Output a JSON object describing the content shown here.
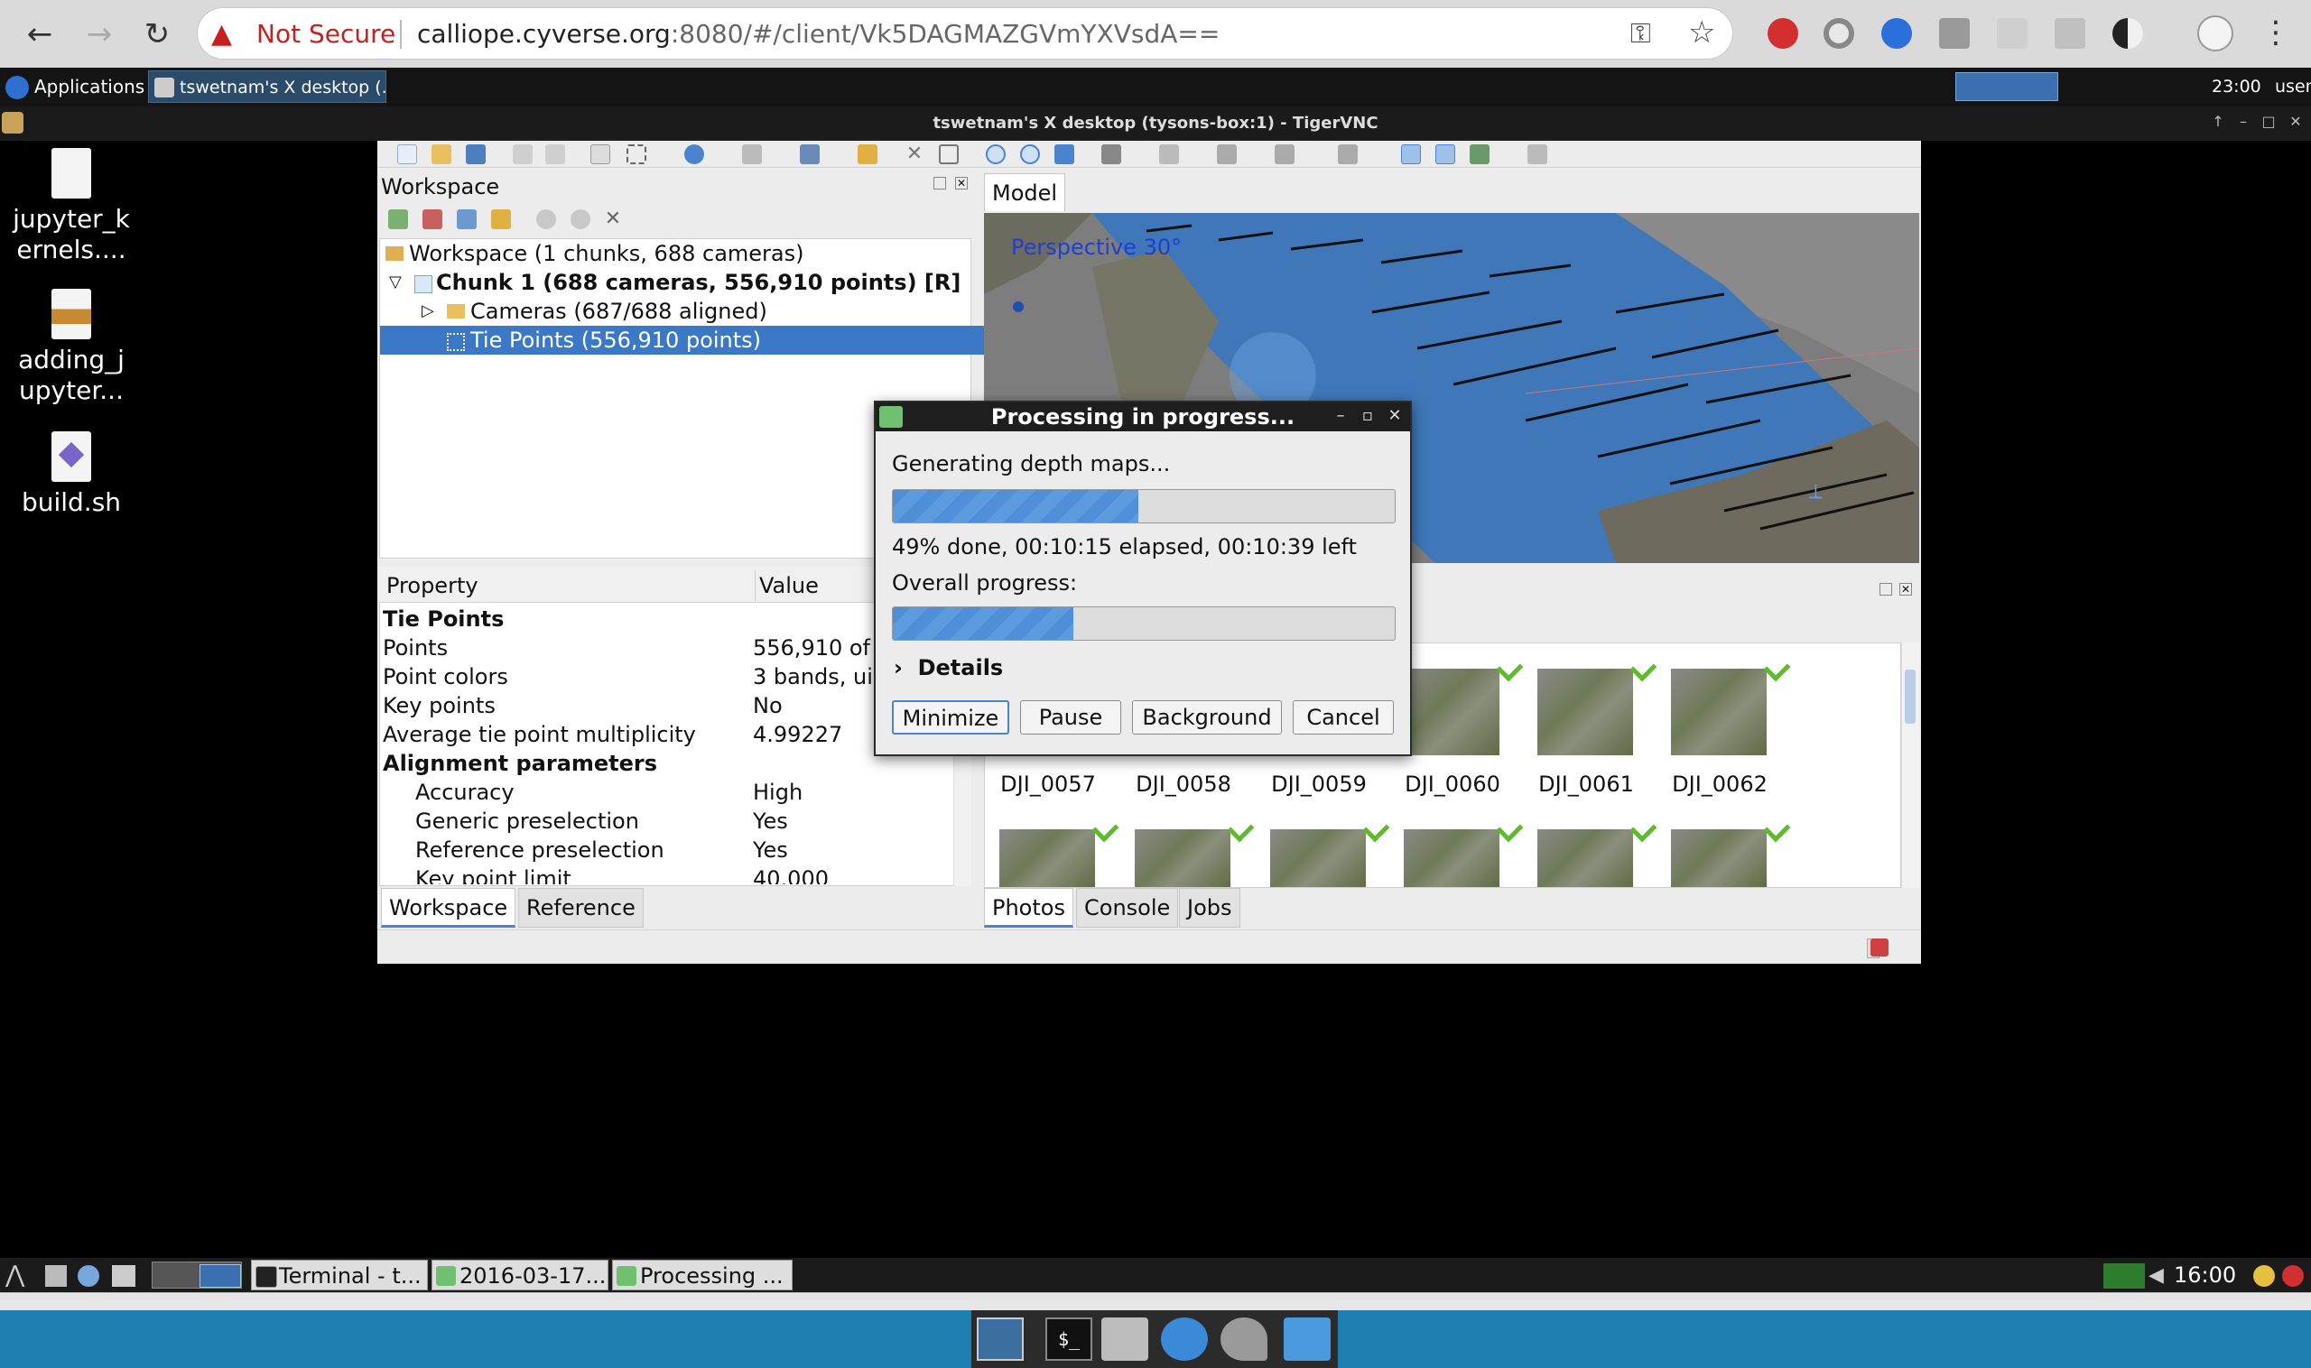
{
  "browser": {
    "security_label": "Not Secure",
    "url_host": "calliope.cyverse.org",
    "url_rest": ":8080/#/client/Vk5DAGMAZGVmYXVsdA=="
  },
  "xpanel": {
    "applications_label": "Applications",
    "task_label": "tswetnam's X desktop (...",
    "clock": "23:00",
    "user": "user"
  },
  "vnc": {
    "title": "tswetnam's X desktop (tysons-box:1) - TigerVNC"
  },
  "desktop_icons": [
    {
      "line1": "jupyter_k",
      "line2": "ernels...."
    },
    {
      "line1": "adding_j",
      "line2": "upyter..."
    },
    {
      "line1": "build.sh",
      "line2": ""
    }
  ],
  "workspace": {
    "title": "Workspace",
    "tree": [
      "Workspace (1 chunks, 688 cameras)",
      "Chunk 1 (688 cameras, 556,910 points) [R]",
      "Cameras (687/688 aligned)",
      "Tie Points (556,910 points)"
    ]
  },
  "properties": {
    "col_property": "Property",
    "col_value": "Value",
    "rows": [
      {
        "name": "Tie Points",
        "value": ""
      },
      {
        "name": "Points",
        "value": "556,910 of"
      },
      {
        "name": "Point colors",
        "value": "3 bands, ui"
      },
      {
        "name": "Key points",
        "value": "No"
      },
      {
        "name": "Average tie point multiplicity",
        "value": "4.99227"
      },
      {
        "name": "Alignment parameters",
        "value": ""
      },
      {
        "name": "Accuracy",
        "value": "High"
      },
      {
        "name": "Generic preselection",
        "value": "Yes"
      },
      {
        "name": "Reference preselection",
        "value": "Yes"
      },
      {
        "name": "Key point limit",
        "value": "40,000"
      }
    ]
  },
  "left_tabs": [
    "Workspace",
    "Reference"
  ],
  "model": {
    "tab": "Model",
    "overlay": "Perspective 30°"
  },
  "photos": {
    "captions": [
      "DJI_0057",
      "DJI_0058",
      "DJI_0059",
      "DJI_0060",
      "DJI_0061",
      "DJI_0062"
    ]
  },
  "right_tabs": [
    "Photos",
    "Console",
    "Jobs"
  ],
  "dialog": {
    "title": "Processing in progress...",
    "stage": "Generating depth maps...",
    "stage_progress": 0.49,
    "status": "49% done, 00:10:15 elapsed, 00:10:39 left",
    "overall_label": "Overall progress:",
    "overall_progress": 0.36,
    "details_label": "Details",
    "buttons": {
      "minimize": "Minimize",
      "pause": "Pause",
      "background": "Background",
      "cancel": "Cancel"
    }
  },
  "x_taskbar": {
    "tasks": [
      "Terminal - t...",
      "2016-03-17...",
      "Processing ..."
    ],
    "clock": "16:00"
  },
  "colors": {
    "accent": "#3b79c7",
    "warning": "#c5221f",
    "dock": "#1f7fb0"
  }
}
